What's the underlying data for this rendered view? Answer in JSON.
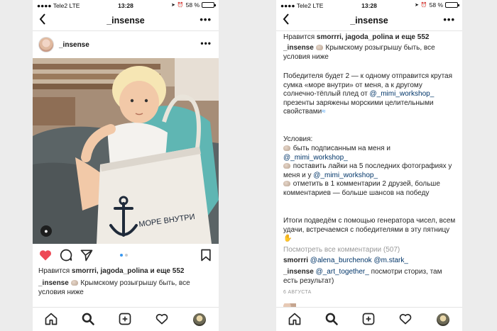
{
  "left": {
    "status": {
      "carrier": "Tele2",
      "network": "LTE",
      "time": "13:28",
      "battery": "58 %"
    },
    "nav": {
      "title": "_insense",
      "more": "•••"
    },
    "post": {
      "username": "_insense",
      "more": "•••",
      "likes_prefix": "Нравится ",
      "likes_users": "smorrri, jagoda_polina",
      "likes_suffix": " и еще 552",
      "caption_user": "_insense",
      "caption_text": " Крымскому розыгрышу быть, все условия ниже",
      "bag_text": "МОРЕ ВНУТРИ"
    }
  },
  "right": {
    "status": {
      "carrier": "Tele2",
      "network": "LTE",
      "time": "13:28",
      "battery": "58 %"
    },
    "nav": {
      "title": "_insense",
      "more": "•••"
    },
    "likes_prefix": "Нравится ",
    "likes_users": "smorrri, jagoda_polina",
    "likes_suffix": " и еще 552",
    "caption_user": "_insense",
    "caption_intro": " Крымскому розыгрышу быть, все условия ниже",
    "para1_a": "Победителя будет 2 — к одному отправится крутая сумка «море внутри» от меня, а к другому солнечно-тёплый плед от ",
    "para1_link": "@_mimi_workshop_",
    "para1_b": " презенты заряжены морскими целительными свойствами",
    "conditions_title": "Условия:",
    "cond1_a": " быть подписанным на меня и ",
    "cond1_link": "@_mimi_workshop_",
    "cond2_a": " поставить лайки на 5 последних фотографиях у меня и у ",
    "cond2_link": "@_mimi_workshop_",
    "cond3": " отметить в 1 комментарии 2 друзей, больше комментариев — больше шансов на победу",
    "para3": "Итоги подведём с помощью генератора чисел, всем удачи, встречаемся с победителями в эту пятницу",
    "view_all": "Посмотреть все комментарии (507)",
    "comment1_user": "smorrri",
    "comment1_text": "@alena_burchenok @m.stark_",
    "comment2_user": "_insense",
    "comment2_link": "@_art_together_",
    "comment2_text": " посмотри сториз, там есть результат)",
    "date": "6 АВГУСТА"
  }
}
